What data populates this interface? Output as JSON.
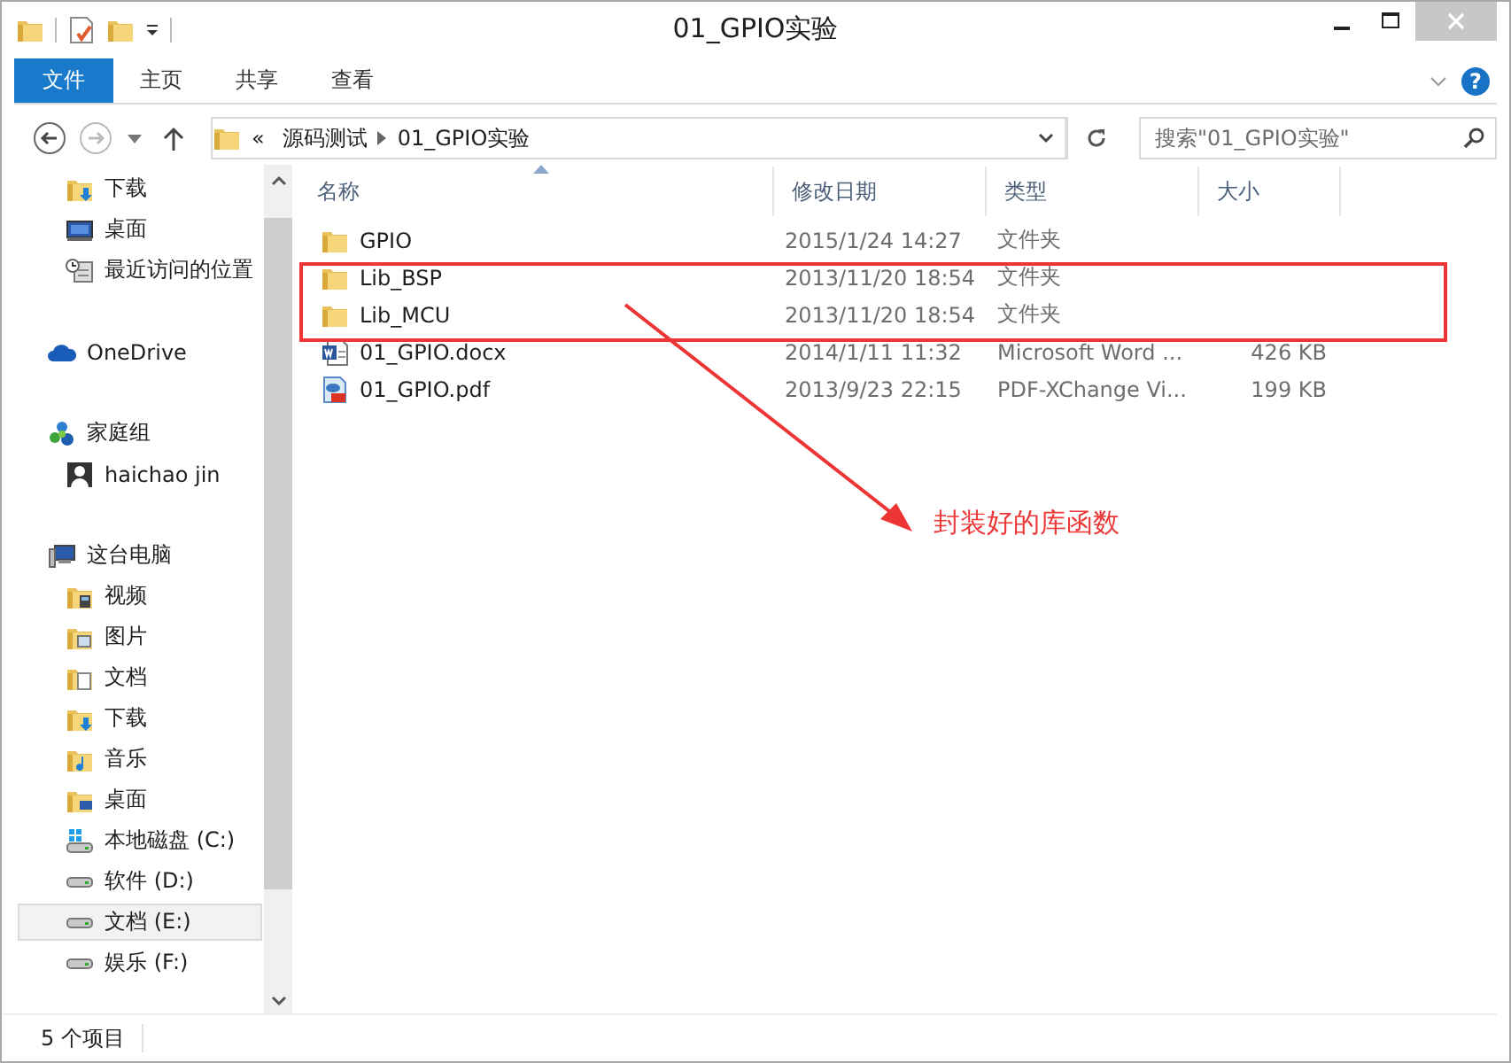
{
  "window": {
    "title": "01_GPIO实验"
  },
  "ribbon": {
    "tabs": [
      {
        "label": "文件",
        "kind": "file"
      },
      {
        "label": "主页",
        "kind": "tab"
      },
      {
        "label": "共享",
        "kind": "tab"
      },
      {
        "label": "查看",
        "kind": "tab"
      }
    ],
    "help": "?"
  },
  "address_bar": {
    "overflow": "«",
    "path": [
      "源码测试",
      "01_GPIO实验"
    ]
  },
  "search": {
    "placeholder": "搜索\"01_GPIO实验\""
  },
  "navigation_pane": {
    "groups": [
      {
        "items": [
          {
            "label": "下载",
            "kind": "downloads",
            "selected": false
          },
          {
            "label": "桌面",
            "kind": "desktop",
            "selected": false
          },
          {
            "label": "最近访问的位置",
            "kind": "recent",
            "selected": false
          }
        ]
      },
      {
        "label": "OneDrive",
        "kind": "cloud",
        "selected": false
      },
      {
        "label": "家庭组",
        "kind": "homegroup",
        "selected": false,
        "children": [
          {
            "label": "haichao jin",
            "kind": "user",
            "selected": false
          }
        ]
      },
      {
        "label": "这台电脑",
        "kind": "computer",
        "selected": false,
        "children": [
          {
            "label": "视频",
            "kind": "videos",
            "selected": false
          },
          {
            "label": "图片",
            "kind": "pictures",
            "selected": false
          },
          {
            "label": "文档",
            "kind": "documents",
            "selected": false
          },
          {
            "label": "下载",
            "kind": "downloads",
            "selected": false
          },
          {
            "label": "音乐",
            "kind": "music",
            "selected": false
          },
          {
            "label": "桌面",
            "kind": "desktop-folder",
            "selected": false
          },
          {
            "label": "本地磁盘 (C:)",
            "kind": "system-drive",
            "selected": false
          },
          {
            "label": "软件 (D:)",
            "kind": "drive",
            "selected": false
          },
          {
            "label": "文档 (E:)",
            "kind": "drive",
            "selected": true
          },
          {
            "label": "娱乐 (F:)",
            "kind": "drive",
            "selected": false
          }
        ]
      }
    ]
  },
  "file_list": {
    "columns": [
      "名称",
      "修改日期",
      "类型",
      "大小"
    ],
    "rows": [
      {
        "name": "GPIO",
        "date": "2015/1/24 14:27",
        "type": "文件夹",
        "kind": "folder"
      },
      {
        "name": "Lib_BSP",
        "date": "2013/11/20 18:54",
        "type": "文件夹",
        "kind": "folder"
      },
      {
        "name": "Lib_MCU",
        "date": "2013/11/20 18:54",
        "type": "文件夹",
        "kind": "folder"
      },
      {
        "name": "01_GPIO.docx",
        "date": "2014/1/11 11:32",
        "type": "Microsoft Word ...",
        "size": "426 KB",
        "kind": "word"
      },
      {
        "name": "01_GPIO.pdf",
        "date": "2013/9/23 22:15",
        "type": "PDF-XChange Vi...",
        "size": "199 KB",
        "kind": "pdf"
      }
    ]
  },
  "annotation": {
    "text": "封装好的库函数"
  },
  "status_bar": {
    "item_count": "5 个项目"
  }
}
